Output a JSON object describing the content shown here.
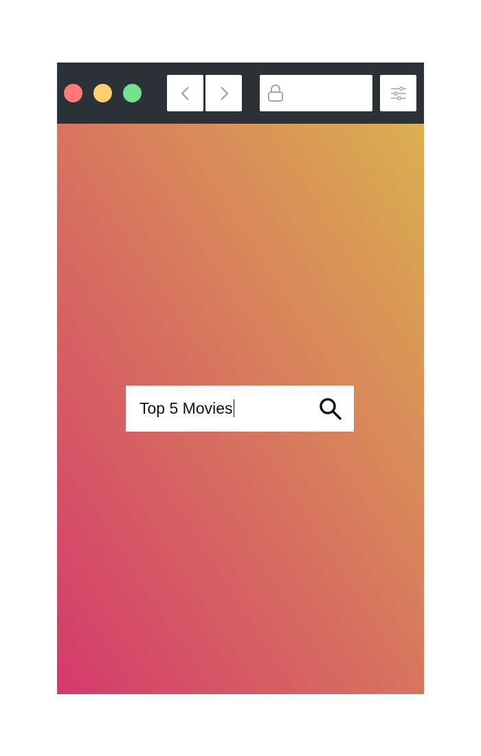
{
  "window": {
    "title_bar_color": "#2b3338",
    "traffic_lights": [
      {
        "name": "close",
        "color": "#ff7b7b"
      },
      {
        "name": "minimize",
        "color": "#ffcf70"
      },
      {
        "name": "maximize",
        "color": "#72e28c"
      }
    ]
  },
  "toolbar": {
    "back_icon": "chevron-left-icon",
    "forward_icon": "chevron-right-icon",
    "address_icon": "lock-icon",
    "address_value": "",
    "settings_icon": "sliders-icon"
  },
  "content": {
    "gradient_from": "#d43a6c",
    "gradient_to": "#dab050"
  },
  "search": {
    "value": "Top 5 Movies",
    "icon": "search-icon"
  }
}
